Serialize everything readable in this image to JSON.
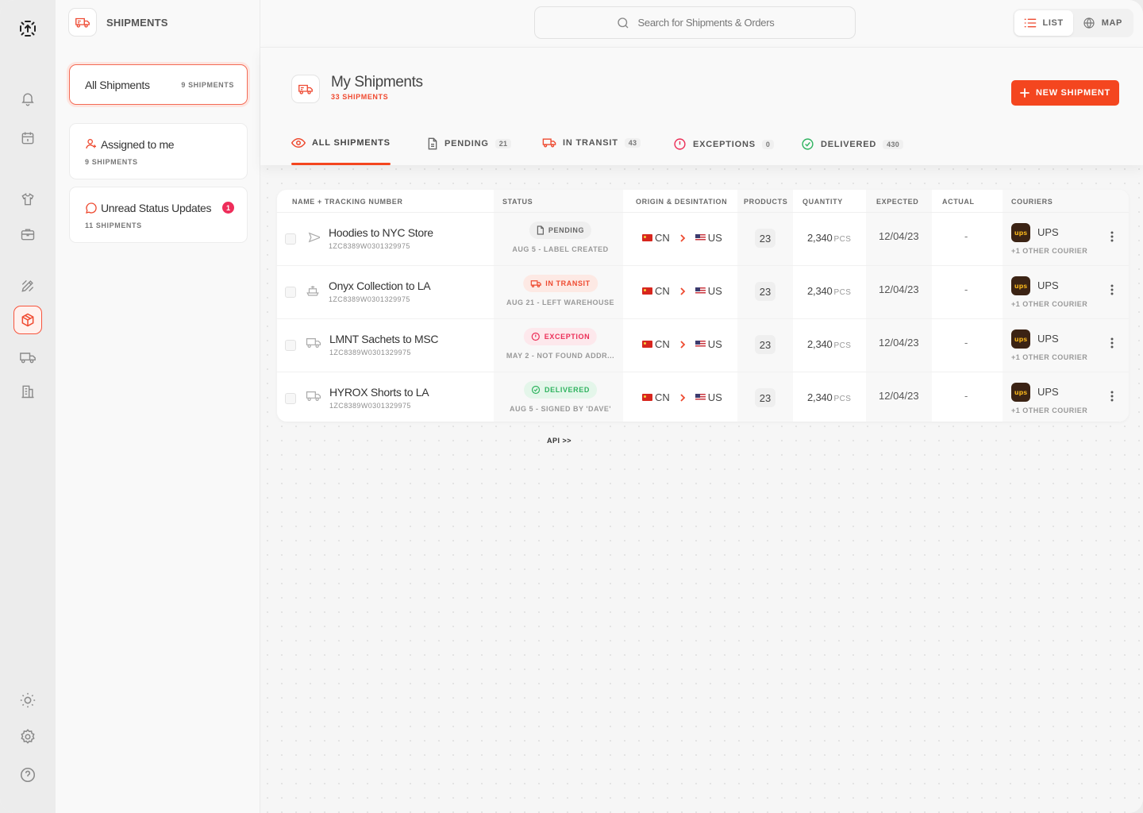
{
  "app": {
    "section_title": "SHIPMENTS",
    "search_placeholder": "Search for Shipments & Orders",
    "view_toggle": {
      "list": "LIST",
      "map": "MAP"
    }
  },
  "sidebar": {
    "cards": [
      {
        "title": "All Shipments",
        "sub": "9 SHIPMENTS"
      },
      {
        "title": "Assigned to me",
        "sub": "9 SHIPMENTS"
      },
      {
        "title": "Unread Status Updates",
        "sub": "11 SHIPMENTS",
        "badge": "1"
      }
    ]
  },
  "main": {
    "title": "My Shipments",
    "subtitle": "33 SHIPMENTS",
    "new_button": "NEW SHIPMENT",
    "tabs": [
      {
        "label": "ALL SHIPMENTS",
        "count": ""
      },
      {
        "label": "PENDING",
        "count": "21"
      },
      {
        "label": "IN TRANSIT",
        "count": "43"
      },
      {
        "label": "EXCEPTIONS",
        "count": "0"
      },
      {
        "label": "DELIVERED",
        "count": "430"
      }
    ],
    "table": {
      "headers": {
        "name": "NAME + TRACKING NUMBER",
        "status": "STATUS",
        "route": "ORIGIN & DESINTATION",
        "products": "PRODUCTS",
        "quantity": "QUANTITY",
        "expected": "EXPECTED",
        "actual": "ACTUAL",
        "couriers": "COURIERS"
      },
      "rows": [
        {
          "name": "Hoodies to NYC Store",
          "tracking": "1ZC8389W0301329975",
          "status": "PENDING",
          "status_sub": "AUG 5 - LABEL CREATED",
          "origin": "CN",
          "destination": "US",
          "products": "23",
          "quantity": "2,340",
          "unit": "PCS",
          "expected": "12/04/23",
          "actual": "-",
          "courier": "UPS",
          "courier_sub": "+1 OTHER COURIER"
        },
        {
          "name": "Onyx Collection to LA",
          "tracking": "1ZC8389W0301329975",
          "status": "IN TRANSIT",
          "status_sub": "AUG 21 - LEFT WAREHOUSE",
          "origin": "CN",
          "destination": "US",
          "products": "23",
          "quantity": "2,340",
          "unit": "PCS",
          "expected": "12/04/23",
          "actual": "-",
          "courier": "UPS",
          "courier_sub": "+1 OTHER COURIER"
        },
        {
          "name": "LMNT Sachets to MSC",
          "tracking": "1ZC8389W0301329975",
          "status": "EXCEPTION",
          "status_sub": "MAY 2 - NOT FOUND ADDR...",
          "origin": "CN",
          "destination": "US",
          "products": "23",
          "quantity": "2,340",
          "unit": "PCS",
          "expected": "12/04/23",
          "actual": "-",
          "courier": "UPS",
          "courier_sub": "+1 OTHER COURIER"
        },
        {
          "name": "HYROX Shorts to LA",
          "tracking": "1ZC8389W0301329975",
          "status": "DELIVERED",
          "status_sub": "AUG 5 - SIGNED BY 'DAVE'",
          "origin": "CN",
          "destination": "US",
          "products": "23",
          "quantity": "2,340",
          "unit": "PCS",
          "expected": "12/04/23",
          "actual": "-",
          "courier": "UPS",
          "courier_sub": "+1 OTHER COURIER"
        }
      ]
    },
    "api_link": "API >>",
    "ups_logo_text": "ups"
  },
  "colors": {
    "accent": "#f4461f",
    "exception": "#ec2e57",
    "delivered": "#2fb35f"
  }
}
